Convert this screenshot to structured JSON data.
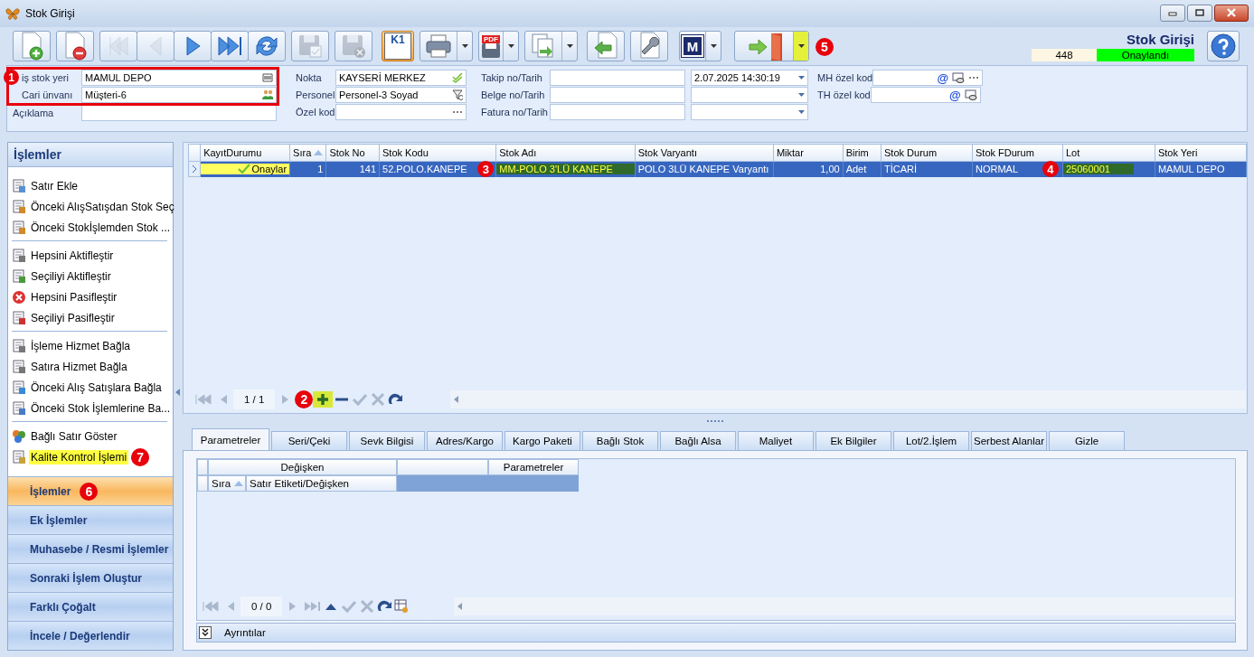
{
  "window": {
    "title": "Stok Girişi"
  },
  "toolbar": {
    "groups": [
      [
        {
          "kind": "new",
          "disabled": false
        }
      ],
      [
        {
          "kind": "delete",
          "disabled": false
        }
      ],
      [
        {
          "kind": "first",
          "disabled": true
        },
        {
          "kind": "prev",
          "disabled": true
        },
        {
          "kind": "next",
          "disabled": false
        },
        {
          "kind": "last",
          "disabled": false
        },
        {
          "kind": "refresh",
          "disabled": false
        }
      ],
      [
        {
          "kind": "save",
          "disabled": true
        }
      ],
      [
        {
          "kind": "save-cancel",
          "disabled": true
        }
      ],
      [
        {
          "kind": "badge",
          "label": "K1",
          "disabled": false,
          "active": true
        }
      ],
      [
        {
          "kind": "print",
          "disabled": false,
          "dropdown": true
        }
      ],
      [
        {
          "kind": "pdf",
          "label": "PDF",
          "disabled": false,
          "dropdown": true
        }
      ],
      [
        {
          "kind": "copy",
          "disabled": false,
          "dropdown": true
        }
      ],
      [
        {
          "kind": "back",
          "disabled": false
        }
      ],
      [
        {
          "kind": "wrench",
          "disabled": false
        }
      ],
      [
        {
          "kind": "letter",
          "label": "M",
          "disabled": false,
          "dropdown": true
        }
      ],
      [
        {
          "kind": "exit",
          "disabled": false,
          "dropdown": true,
          "highlighted": true,
          "callout": "5"
        }
      ]
    ],
    "title": "Stok Girişi",
    "record_no": "448",
    "status": {
      "text": "Onaylandı",
      "color": "#00ff00"
    }
  },
  "form": {
    "columns": [
      {
        "framed": [
          {
            "label": "iş stok yeri",
            "value": "MAMUL DEPO",
            "kind": "barcode"
          },
          {
            "label": "Cari ünvanı",
            "value": "Müşteri-6",
            "kind": "people"
          }
        ],
        "callout": "1",
        "fields": [
          {
            "label": "Açıklama",
            "kind": "plain"
          }
        ]
      },
      {
        "fields": [
          {
            "label": "Nokta",
            "value": "KAYSERİ MERKEZ",
            "kind": "check"
          },
          {
            "label": "Personel",
            "value": "Personel-3 Soyad",
            "kind": "filter"
          },
          {
            "label": "Özel kod",
            "kind": "dots"
          }
        ]
      },
      {
        "fields": [
          {
            "label": "Takip no/Tarih",
            "kind": "date",
            "date": "2.07.2025 14:30:19"
          },
          {
            "label": "Belge no/Tarih",
            "kind": "date"
          },
          {
            "label": "Fatura no/Tarih",
            "kind": "date"
          }
        ]
      },
      {
        "fields": [
          {
            "label": "MH özel kod",
            "kind": "code",
            "at": "@",
            "dots": true
          },
          {
            "label": "TH özel kod",
            "kind": "code",
            "at": "@",
            "dots": false
          }
        ]
      }
    ]
  },
  "sidebar": {
    "title": "İşlemler",
    "sections": [
      [
        {
          "label": "Satır Ekle",
          "highlighted": false
        },
        {
          "label": "Önceki AlışSatışdan Stok Seç",
          "highlighted": false
        },
        {
          "label": "Önceki Stokİşlemden Stok ...",
          "highlighted": false
        }
      ],
      [
        {
          "label": "Hepsini Aktifleştir",
          "highlighted": false
        },
        {
          "label": "Seçiliyi Aktifleştir",
          "highlighted": false
        },
        {
          "label": "Hepsini Pasifleştir",
          "highlighted": false
        },
        {
          "label": "Seçiliyi Pasifleştir",
          "highlighted": false
        }
      ],
      [
        {
          "label": "İşleme Hizmet Bağla",
          "highlighted": false
        },
        {
          "label": "Satıra Hizmet Bağla",
          "highlighted": false
        },
        {
          "label": "Önceki Alış Satışlara Bağla",
          "highlighted": false
        },
        {
          "label": "Önceki Stok İşlemlerine Ba...",
          "highlighted": false
        }
      ],
      [
        {
          "label": "Bağlı Satır Göster",
          "highlighted": false
        },
        {
          "label": "Kalite Kontrol İşlemi",
          "highlighted": true,
          "callout": "7"
        }
      ]
    ],
    "nav": [
      {
        "label": "İşlemler",
        "selected": true,
        "callout": "6"
      },
      {
        "label": "Ek İşlemler",
        "selected": false
      },
      {
        "label": "Muhasebe / Resmi İşlemler",
        "selected": false
      },
      {
        "label": "Sonraki İşlem Oluştur",
        "selected": false
      },
      {
        "label": "Farklı Çoğalt",
        "selected": false
      },
      {
        "label": "İncele / Değerlendir",
        "selected": false
      }
    ]
  },
  "grid": {
    "columns": [
      {
        "label": "KayıtDurumu"
      },
      {
        "label": "Sıra",
        "sorted": true
      },
      {
        "label": "Stok No"
      },
      {
        "label": "Stok Kodu"
      },
      {
        "label": "Stok Adı"
      },
      {
        "label": "Stok Varyantı"
      },
      {
        "label": "Miktar"
      },
      {
        "label": "Birim"
      },
      {
        "label": "Stok Durum"
      },
      {
        "label": "Stok FDurum"
      },
      {
        "label": "Lot"
      },
      {
        "label": "Stok Yeri"
      }
    ],
    "rows": [
      {
        "selected": true,
        "cells": [
          {
            "text": "Onaylar",
            "kind": "status"
          },
          {
            "text": "1",
            "kind": "number"
          },
          {
            "text": "141",
            "kind": "number"
          },
          {
            "text": "52.POLO.KANEPE",
            "kind": "text",
            "callout": "3"
          },
          {
            "text": "MM-POLO 3'LÜ KANEPE",
            "kind": "green"
          },
          {
            "text": "POLO 3LÜ KANEPE Varyantı",
            "kind": "text"
          },
          {
            "text": "1,00",
            "kind": "number"
          },
          {
            "text": "Adet",
            "kind": "text"
          },
          {
            "text": "TİCARİ",
            "kind": "text"
          },
          {
            "text": "NORMAL",
            "kind": "text",
            "callout": "4"
          },
          {
            "text": "25060001",
            "kind": "green"
          },
          {
            "text": "MAMUL DEPO",
            "kind": "text"
          }
        ]
      }
    ],
    "pager": {
      "text": "1 / 1",
      "callout": "2",
      "add_highlighted": true
    }
  },
  "detail": {
    "tabs": [
      {
        "label": "Parametreler",
        "selected": true
      },
      {
        "label": "Seri/Çeki",
        "selected": false
      },
      {
        "label": "Sevk Bilgisi",
        "selected": false
      },
      {
        "label": "Adres/Kargo",
        "selected": false
      },
      {
        "label": "Kargo Paketi",
        "selected": false
      },
      {
        "label": "Bağlı Stok",
        "selected": false
      },
      {
        "label": "Bağlı Alsa",
        "selected": false
      },
      {
        "label": "Maliyet",
        "selected": false
      },
      {
        "label": "Ek Bilgiler",
        "selected": false
      },
      {
        "label": "Lot/2.İşlem",
        "selected": false
      },
      {
        "label": "Serbest Alanlar",
        "selected": false
      },
      {
        "label": "Gizle",
        "selected": false
      }
    ],
    "bands": [
      {
        "label": "Değişken"
      },
      {
        "label": "Parametreler"
      }
    ],
    "columns": [
      {
        "label": "Sıra",
        "sorted": true
      },
      {
        "label": "Satır Etiketi/Değişken"
      }
    ],
    "pager": {
      "text": "0 / 0"
    },
    "details_bar": {
      "label": "Ayrıntılar"
    }
  }
}
